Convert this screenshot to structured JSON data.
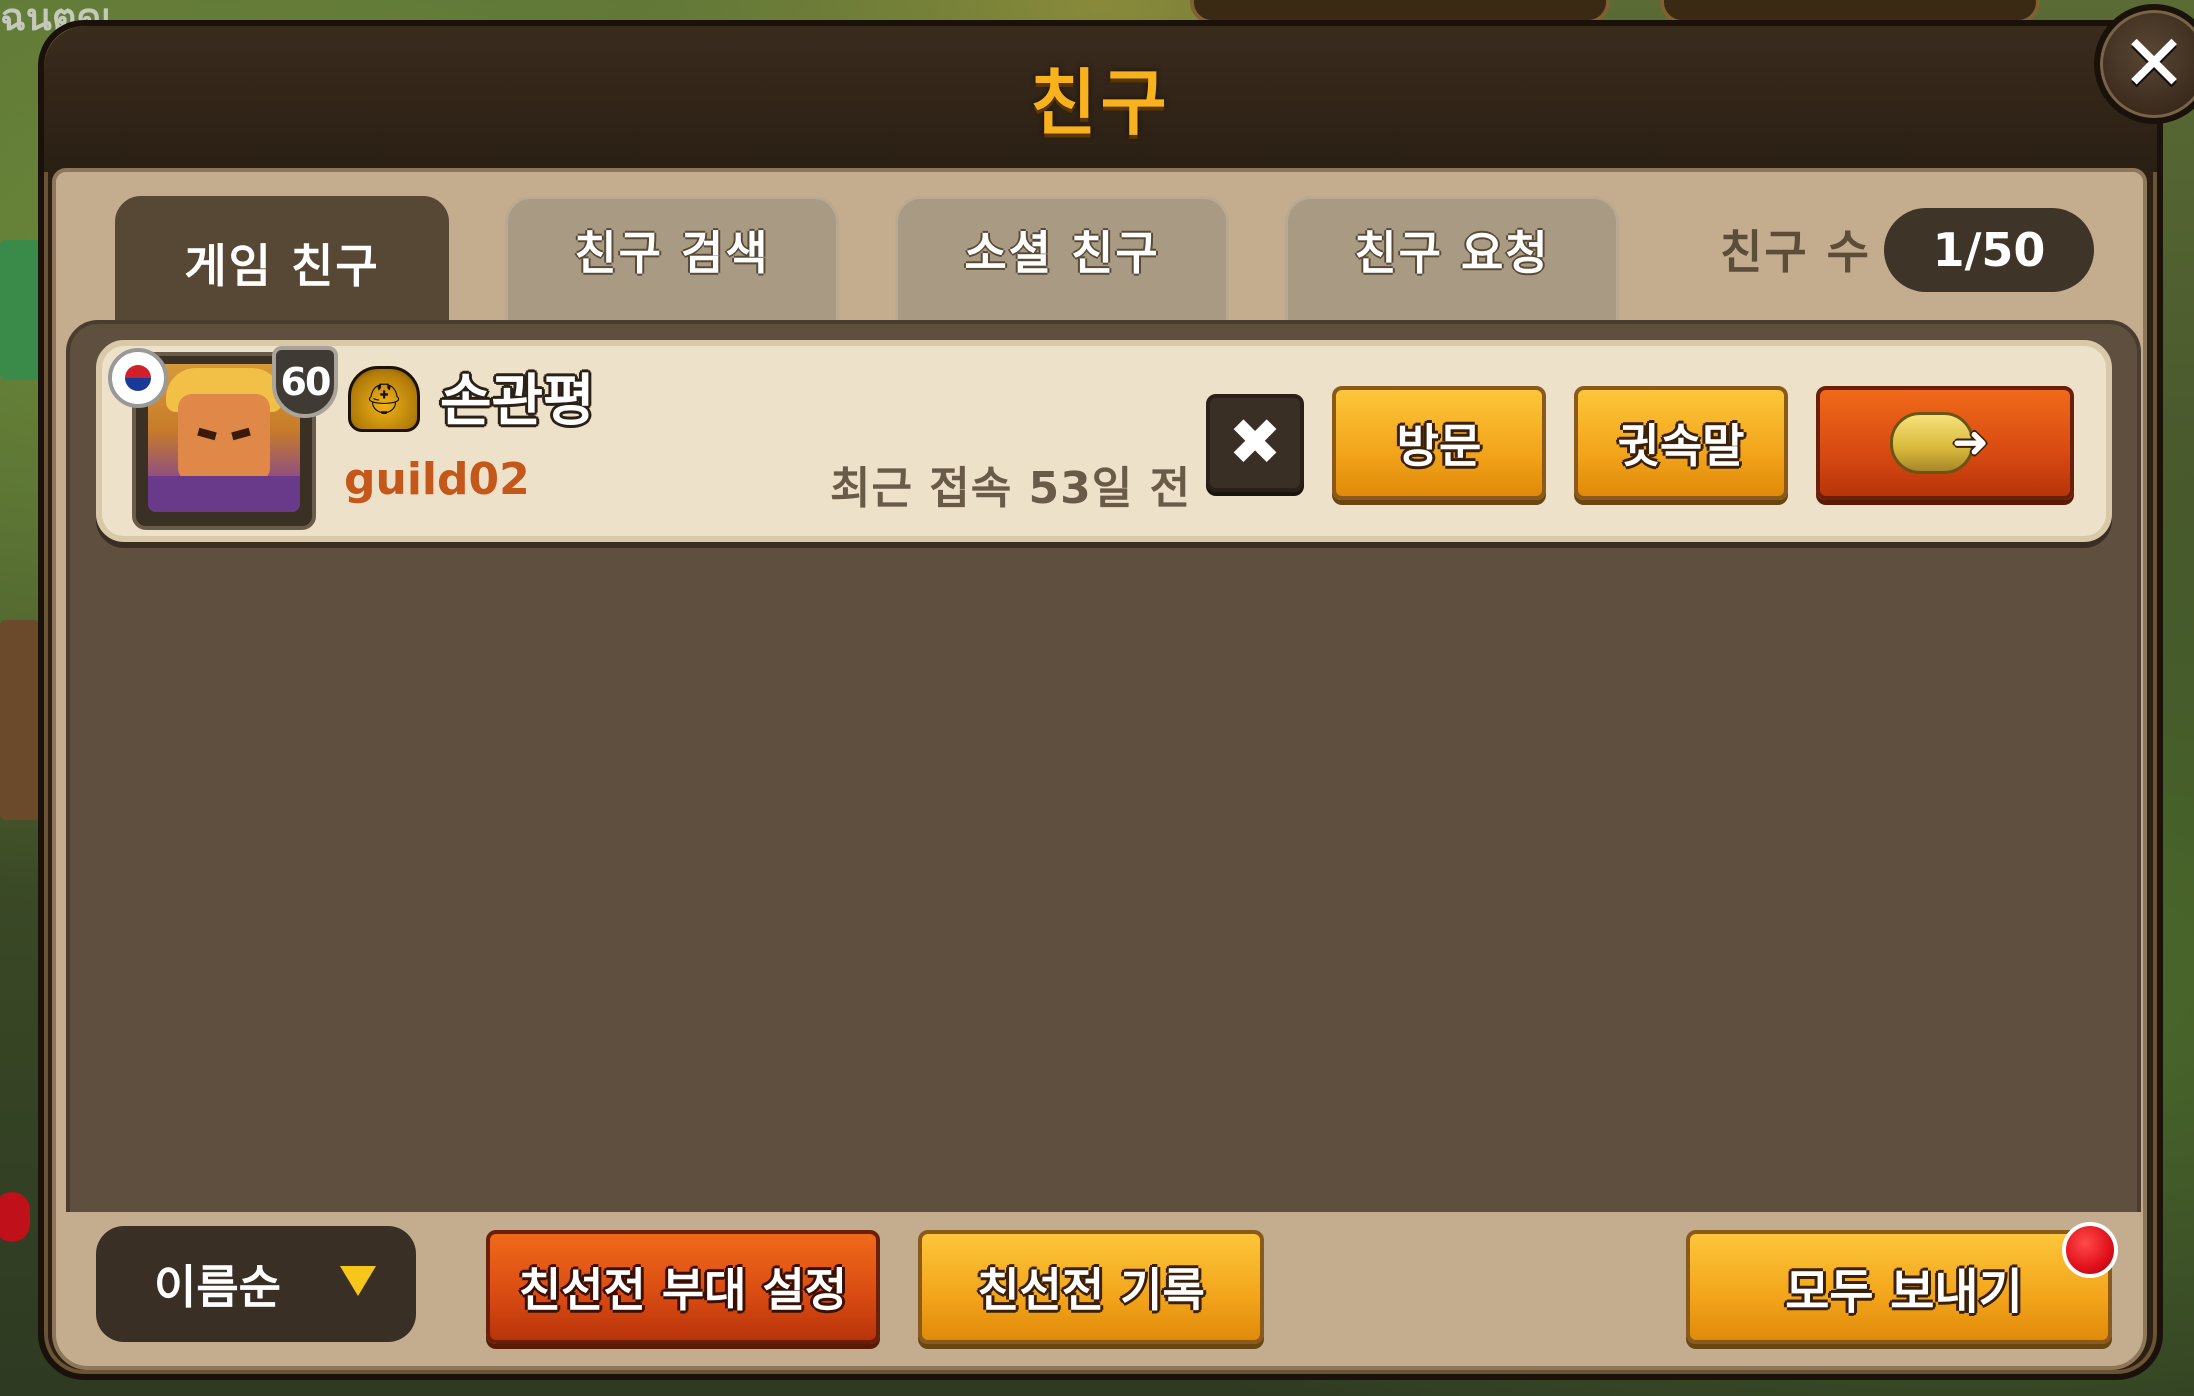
{
  "background": {
    "corner_text": "ฉนตุดเ"
  },
  "dialog": {
    "title": "친구",
    "close_symbol": "✕"
  },
  "tabs": [
    {
      "label": "게임 친구",
      "active": true
    },
    {
      "label": "친구 검색",
      "active": false
    },
    {
      "label": "소셜 친구",
      "active": false
    },
    {
      "label": "친구 요청",
      "active": false
    }
  ],
  "friend_count": {
    "label": "친구 수",
    "value": "1/50"
  },
  "friends": [
    {
      "level": "60",
      "name": "손관평",
      "guild": "guild02",
      "last_login": "최근 접속 53일 전",
      "flag": "korea-flag-icon",
      "rank_icon": "helmet-rank-icon",
      "delete_symbol": "✖",
      "visit_label": "방문",
      "whisper_label": "귓속말",
      "gift_icon": "send-gift-icon"
    }
  ],
  "bottom": {
    "sort_label": "이름순",
    "squad_label": "친선전 부대 설정",
    "record_label": "친선전 기록",
    "send_all_label": "모두 보내기"
  },
  "colors": {
    "title": "#f7b21e",
    "orange_button": "#f2a41a",
    "red_button": "#d84a12",
    "guild_text": "#c4571a",
    "notification": "#e0101a"
  }
}
